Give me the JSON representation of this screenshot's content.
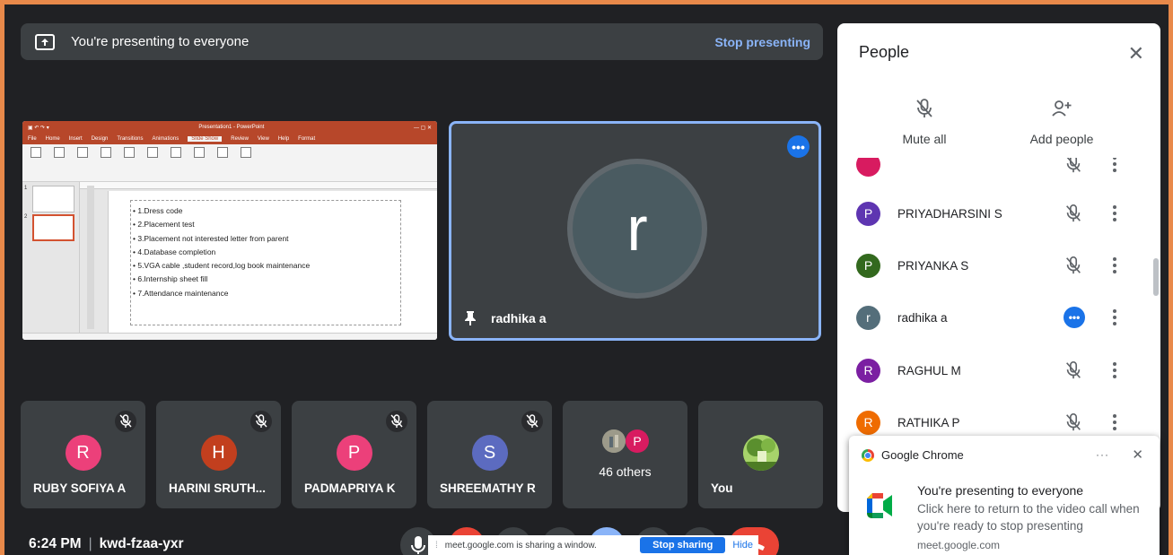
{
  "banner": {
    "title": "You're presenting to everyone",
    "stop_label": "Stop presenting"
  },
  "slide": {
    "window_title": "Presentation1 - PowerPoint",
    "tabs": [
      "File",
      "Home",
      "Insert",
      "Design",
      "Transitions",
      "Animations",
      "Slide Show",
      "Review",
      "View",
      "Help",
      "Format"
    ],
    "active_tab": "Slide Show",
    "bullets": [
      "• 1.Dress code",
      "• 2.Placement test",
      "• 3.Placement not interested letter from parent",
      "• 4.Database completion",
      "• 5.VGA cable ,student record,log book maintenance",
      "• 6.Internship sheet fill",
      "• 7.Attendance maintenance"
    ]
  },
  "pinned": {
    "initial": "r",
    "name": "radhika a",
    "avatar_color": "#4a5b61"
  },
  "tiles": [
    {
      "initial": "R",
      "name": "RUBY SOFIYA A",
      "color": "#ec407a"
    },
    {
      "initial": "H",
      "name": "HARINI SRUTH...",
      "color": "#c23f1e"
    },
    {
      "initial": "P",
      "name": "PADMAPRIYA K",
      "color": "#ec407a"
    },
    {
      "initial": "S",
      "name": "SHREEMATHY R",
      "color": "#5c6bc0"
    }
  ],
  "others": {
    "label": "46 others",
    "initial": "P",
    "color": "#d81b60"
  },
  "self": {
    "name": "You"
  },
  "meeting": {
    "time": "6:24 PM",
    "separator": "|",
    "code": "kwd-fzaa-yxr"
  },
  "share_bar": {
    "message": "meet.google.com is sharing a window.",
    "stop_label": "Stop sharing",
    "hide_label": "Hide"
  },
  "people": {
    "title": "People",
    "mute_all": "Mute all",
    "add_people": "Add people",
    "rows": [
      {
        "initial": "",
        "name": "",
        "color": "#d81b60"
      },
      {
        "initial": "P",
        "name": "PRIYADHARSINI S",
        "color": "#5e35b1"
      },
      {
        "initial": "P",
        "name": "PRIYANKA S",
        "color": "#33691e"
      },
      {
        "initial": "r",
        "name": "radhika a",
        "color": "#546e7a"
      },
      {
        "initial": "R",
        "name": "RAGHUL M",
        "color": "#7b1fa2"
      },
      {
        "initial": "R",
        "name": "RATHIKA P",
        "color": "#ef6c00"
      }
    ]
  },
  "notification": {
    "app": "Google Chrome",
    "dots": "···",
    "title": "You're presenting to everyone",
    "body": "Click here to return to the video call when you're ready to stop presenting",
    "source": "meet.google.com"
  },
  "icons": {
    "present": "present-to-all-icon",
    "mic_off": "mic-off-icon",
    "pin": "pin-icon",
    "close": "close-icon",
    "more": "more-vert-icon"
  }
}
